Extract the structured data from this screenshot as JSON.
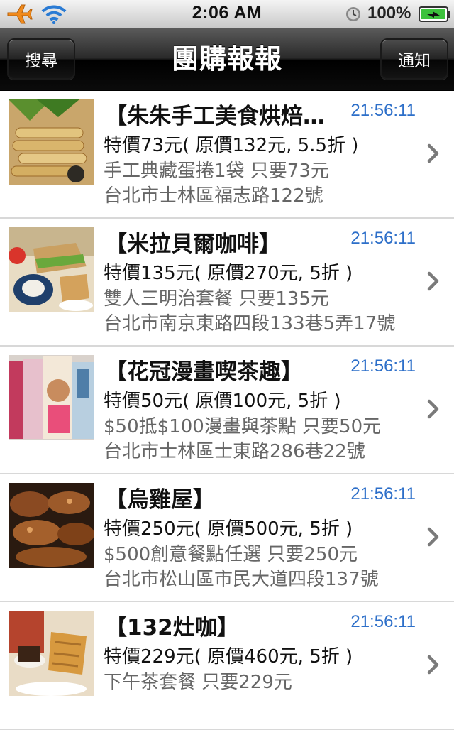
{
  "status_bar": {
    "time": "2:06 AM",
    "battery": "100%"
  },
  "navbar": {
    "title": "團購報報",
    "left_button": "搜尋",
    "right_button": "通知"
  },
  "deals": [
    {
      "title": "【朱朱手工美食烘焙坊】",
      "time": "21:56:11",
      "price": "特價73元( 原價132元, 5.5折 )",
      "desc": "手工典藏蛋捲1袋 只要73元",
      "address": "台北市士林區福志路122號"
    },
    {
      "title": "【米拉貝爾咖啡】",
      "time": "21:56:11",
      "price": "特價135元( 原價270元, 5折 )",
      "desc": "雙人三明治套餐 只要135元",
      "address": "台北市南京東路四段133巷5弄17號"
    },
    {
      "title": "【花冠漫畫喫茶趣】",
      "time": "21:56:11",
      "price": "特價50元( 原價100元, 5折 )",
      "desc": "$50抵$100漫畫與茶點 只要50元",
      "address": "台北市士林區士東路286巷22號"
    },
    {
      "title": "【烏雞屋】",
      "time": "21:56:11",
      "price": "特價250元( 原價500元, 5折 )",
      "desc": "$500創意餐點任選 只要250元",
      "address": "台北市松山區市民大道四段137號"
    },
    {
      "title": "【132灶咖】",
      "time": "21:56:11",
      "price": "特價229元( 原價460元, 5折 )",
      "desc": "下午茶套餐 只要229元",
      "address": ""
    }
  ]
}
